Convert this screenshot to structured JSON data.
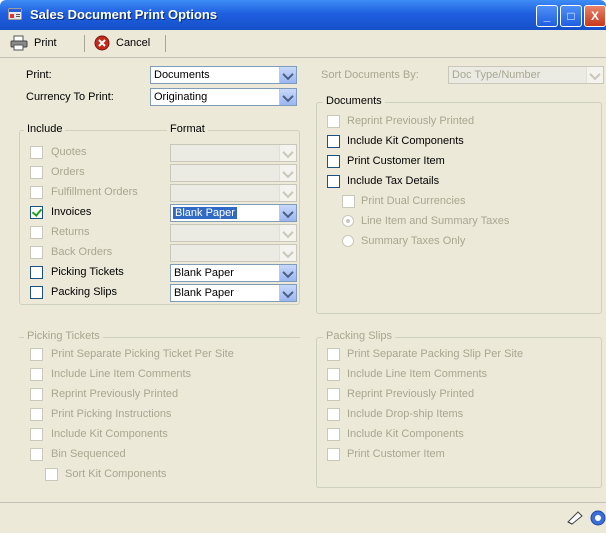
{
  "window": {
    "title": "Sales Document Print Options",
    "min_label": "_",
    "max_label": "□",
    "close_label": "X"
  },
  "toolbar": {
    "print_label": "Print",
    "cancel_label": "Cancel"
  },
  "top": {
    "print_label": "Print:",
    "print_value": "Documents",
    "currency_label": "Currency To Print:",
    "currency_value": "Originating",
    "sort_label": "Sort Documents By:",
    "sort_value": "Doc Type/Number"
  },
  "include": {
    "group_label": "Include",
    "format_label": "Format",
    "items": [
      {
        "label": "Quotes",
        "checked": false,
        "enabled": false,
        "format": ""
      },
      {
        "label": "Orders",
        "checked": false,
        "enabled": false,
        "format": ""
      },
      {
        "label": "Fulfillment Orders",
        "checked": false,
        "enabled": false,
        "format": ""
      },
      {
        "label": "Invoices",
        "checked": true,
        "enabled": true,
        "format": "Blank Paper"
      },
      {
        "label": "Returns",
        "checked": false,
        "enabled": false,
        "format": ""
      },
      {
        "label": "Back Orders",
        "checked": false,
        "enabled": false,
        "format": ""
      },
      {
        "label": "Picking Tickets",
        "checked": false,
        "enabled": true,
        "format": "Blank Paper"
      },
      {
        "label": "Packing Slips",
        "checked": false,
        "enabled": true,
        "format": "Blank Paper"
      }
    ]
  },
  "documents": {
    "group_label": "Documents",
    "reprint": "Reprint Previously Printed",
    "include_kit": "Include Kit Components",
    "print_customer_item": "Print Customer Item",
    "include_tax": "Include Tax Details",
    "print_dual": "Print Dual Currencies",
    "radio_line": "Line Item and Summary Taxes",
    "radio_summary": "Summary Taxes Only"
  },
  "picking": {
    "group_label": "Picking Tickets",
    "items": [
      "Print Separate Picking Ticket Per Site",
      "Include Line Item Comments",
      "Reprint Previously Printed",
      "Print Picking Instructions",
      "Include Kit Components",
      "Bin Sequenced"
    ],
    "sub_item": "Sort Kit Components"
  },
  "packing": {
    "group_label": "Packing Slips",
    "items": [
      "Print Separate Packing Slip Per Site",
      "Include Line Item Comments",
      "Reprint Previously Printed",
      "Include Drop-ship Items",
      "Include Kit Components",
      "Print Customer Item"
    ]
  },
  "colors": {
    "title_bar": "#1f5fe0",
    "face": "#ece9d8",
    "disabled_text": "#a9a690",
    "check": "#21a121"
  }
}
